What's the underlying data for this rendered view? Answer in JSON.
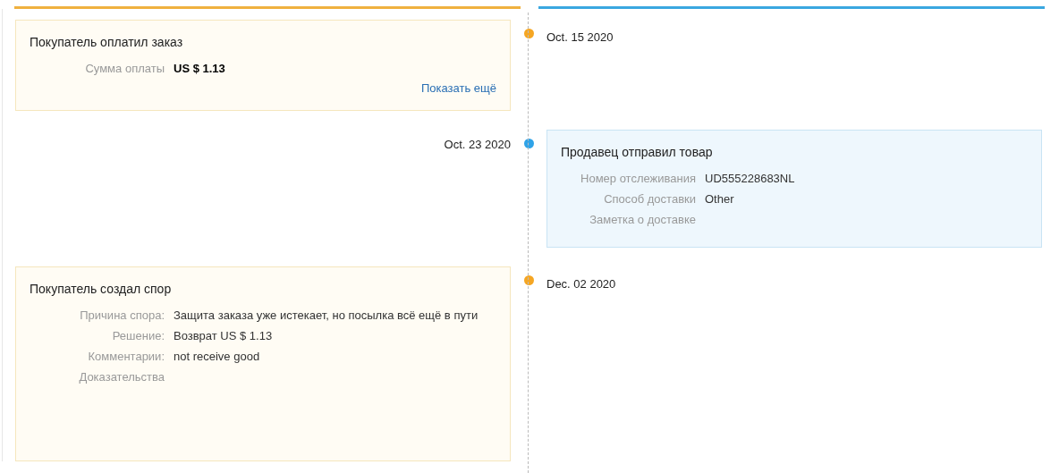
{
  "events": [
    {
      "kind": "left",
      "color": "#f5a623",
      "date": "Oct. 15 2020",
      "title": "Покупатель оплатил заказ",
      "fields": [
        {
          "label": "Сумма оплаты",
          "value": "US $ 1.13",
          "bold": true
        }
      ],
      "link": "Показать ещё"
    },
    {
      "kind": "right",
      "color": "#2fa3e8",
      "date": "Oct. 23 2020",
      "title": "Продавец отправил товар",
      "fields": [
        {
          "label": "Номер отслеживания",
          "value": "UD555228683NL",
          "bold": false
        },
        {
          "label": "Способ доставки",
          "value": "Other",
          "bold": false
        },
        {
          "label": "Заметка о доставке"
        }
      ]
    },
    {
      "kind": "left",
      "color": "#f5a623",
      "date": "Dec. 02 2020",
      "title": "Покупатель создал спор",
      "fields": [
        {
          "label": "Причина спора:",
          "value": "Защита заказа уже истекает, но посылка всё ещё в пути",
          "bold": false
        },
        {
          "label": "Решение:",
          "value": "Возврат US $ 1.13",
          "bold": false
        },
        {
          "label": "Комментарии:",
          "value": "not receive good",
          "bold": false
        },
        {
          "label": "Доказательства"
        }
      ]
    }
  ]
}
